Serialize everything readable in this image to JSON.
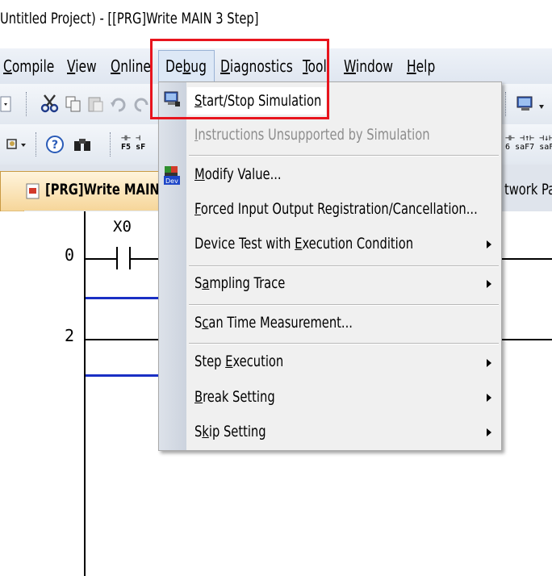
{
  "window": {
    "title": "Untitled Project) - [[PRG]Write MAIN 3 Step]"
  },
  "menubar": {
    "items": [
      {
        "pre": "",
        "u": "C",
        "post": "ompile"
      },
      {
        "pre": "",
        "u": "V",
        "post": "iew"
      },
      {
        "pre": "",
        "u": "O",
        "post": "nline"
      },
      {
        "pre": "De",
        "u": "b",
        "post": "ug"
      },
      {
        "pre": "",
        "u": "D",
        "post": "iagnostics"
      },
      {
        "pre": "",
        "u": "T",
        "post": "ool"
      },
      {
        "pre": "",
        "u": "W",
        "post": "indow"
      },
      {
        "pre": "",
        "u": "H",
        "post": "elp"
      }
    ]
  },
  "toolbar2": {
    "keys": [
      "F5",
      "sF",
      "6",
      "saF7",
      "saF8"
    ]
  },
  "tabs": {
    "active": "[PRG]Write MAIN",
    "partial": "twork Pa"
  },
  "ladder": {
    "rows": [
      "0",
      "2"
    ],
    "contact": "X0"
  },
  "debug_menu": {
    "items": [
      {
        "pre": "",
        "u": "S",
        "post": "tart/Stop Simulation"
      },
      {
        "pre": "",
        "u": "I",
        "post": "nstructions Unsupported by Simulation"
      },
      {
        "pre": "",
        "u": "M",
        "post": "odify Value..."
      },
      {
        "pre": "",
        "u": "F",
        "post": "orced Input Output Registration/Cancellation..."
      },
      {
        "pre": "Device Test with ",
        "u": "E",
        "post": "xecution Condition"
      },
      {
        "pre": "S",
        "u": "a",
        "post": "mpling Trace"
      },
      {
        "pre": "S",
        "u": "c",
        "post": "an Time Measurement..."
      },
      {
        "pre": "Step ",
        "u": "E",
        "post": "xecution"
      },
      {
        "pre": "",
        "u": "B",
        "post": "reak Setting"
      },
      {
        "pre": "S",
        "u": "k",
        "post": "ip Setting"
      }
    ],
    "icon_labels": {
      "dev": "Dev"
    }
  },
  "colors": {
    "highlight": "#e8141d",
    "wire": "#1a2fc4"
  }
}
